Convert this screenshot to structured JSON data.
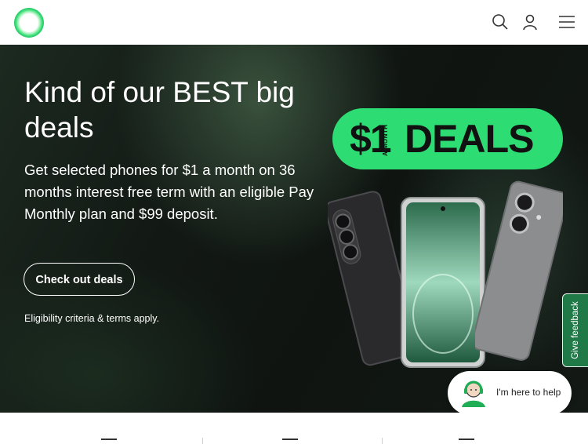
{
  "header": {
    "logo": "brand-logo-ring",
    "icons": [
      "search-icon",
      "user-icon",
      "menu-icon"
    ]
  },
  "hero": {
    "title": "Kind of our BEST big deals",
    "subtitle": "Get selected phones for $1 a month on 36 months interest free term with an eligible Pay Monthly plan and $99 deposit.",
    "cta_label": "Check out deals",
    "fineprint": "Eligibility criteria & terms apply."
  },
  "deals_badge": {
    "price": "$1",
    "per": "A MONTH",
    "word": "DEALS"
  },
  "feedback": {
    "label": "Give feedback"
  },
  "help": {
    "label": "I'm here to help"
  },
  "colors": {
    "accent_green": "#2ddc72",
    "feedback_green": "#1f7a47",
    "hero_dark": "#121814"
  }
}
